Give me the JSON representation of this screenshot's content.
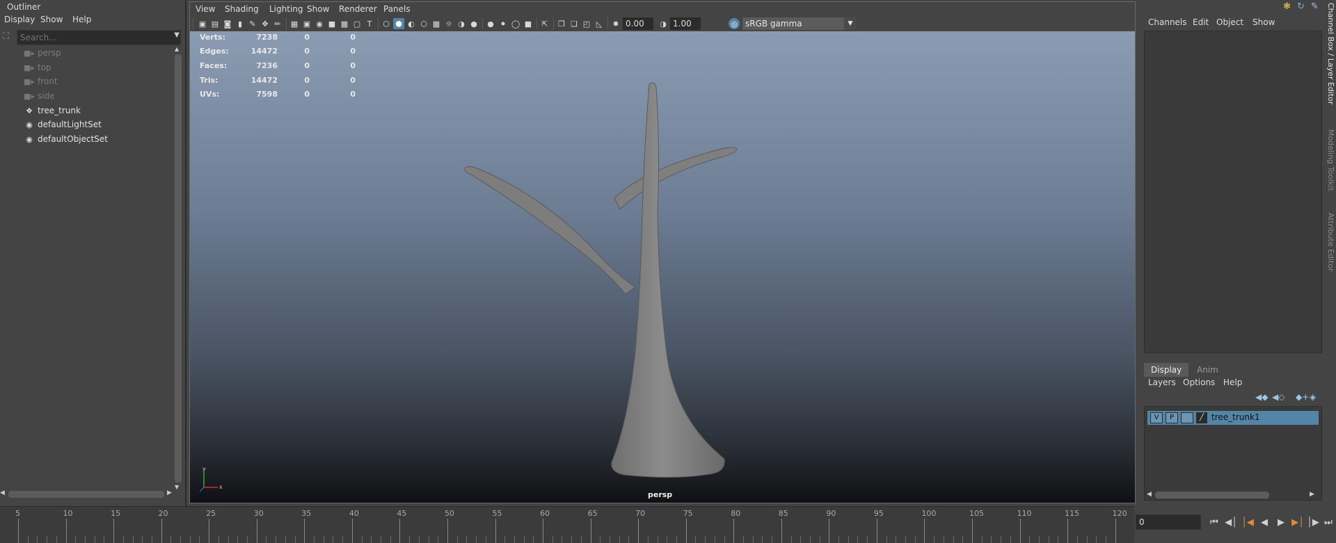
{
  "outliner": {
    "title": "Outliner",
    "menu": [
      "Display",
      "Show",
      "Help"
    ],
    "search_placeholder": "Search...",
    "items": [
      {
        "label": "persp",
        "icon": "camera-icon"
      },
      {
        "label": "top",
        "icon": "camera-icon"
      },
      {
        "label": "front",
        "icon": "camera-icon"
      },
      {
        "label": "side",
        "icon": "camera-icon"
      },
      {
        "label": "tree_trunk",
        "icon": "mesh-transform-icon"
      },
      {
        "label": "defaultLightSet",
        "icon": "set-icon"
      },
      {
        "label": "defaultObjectSet",
        "icon": "set-icon"
      }
    ]
  },
  "viewport": {
    "menu": [
      "View",
      "Shading",
      "Lighting",
      "Show",
      "Renderer",
      "Panels"
    ],
    "exposure": "0.00",
    "gamma": "1.00",
    "color_space": "sRGB gamma",
    "camera_label": "persp",
    "hud": [
      {
        "label": "Verts:",
        "value": "7238",
        "sel": "0",
        "uv": "0"
      },
      {
        "label": "Edges:",
        "value": "14472",
        "sel": "0",
        "uv": "0"
      },
      {
        "label": "Faces:",
        "value": "7236",
        "sel": "0",
        "uv": "0"
      },
      {
        "label": "Tris:",
        "value": "14472",
        "sel": "0",
        "uv": "0"
      },
      {
        "label": "UVs:",
        "value": "7598",
        "sel": "0",
        "uv": "0"
      }
    ],
    "axis": {
      "y": "y",
      "x": "x"
    }
  },
  "channel_box": {
    "menu": [
      "Channels",
      "Edit",
      "Object",
      "Show"
    ]
  },
  "layer_editor": {
    "tabs": [
      "Display",
      "Anim"
    ],
    "active_tab": "Display",
    "menu": [
      "Layers",
      "Options",
      "Help"
    ],
    "layer": {
      "visible": "V",
      "playback": "P",
      "name": "tree_trunk1"
    }
  },
  "side_tabs": [
    "Channel Box / Layer Editor",
    "Modeling Toolkit",
    "Attribute Editor"
  ],
  "timeline": {
    "labels": [
      "5",
      "10",
      "15",
      "20",
      "25",
      "30",
      "35",
      "40",
      "45",
      "50",
      "55",
      "60",
      "65",
      "70",
      "75",
      "80",
      "85",
      "90",
      "95",
      "100",
      "105",
      "110",
      "115",
      "120"
    ],
    "current_frame": "0"
  },
  "colors": {
    "accent": "#5285a6",
    "panel": "#444444",
    "field": "#2b2b2b"
  }
}
